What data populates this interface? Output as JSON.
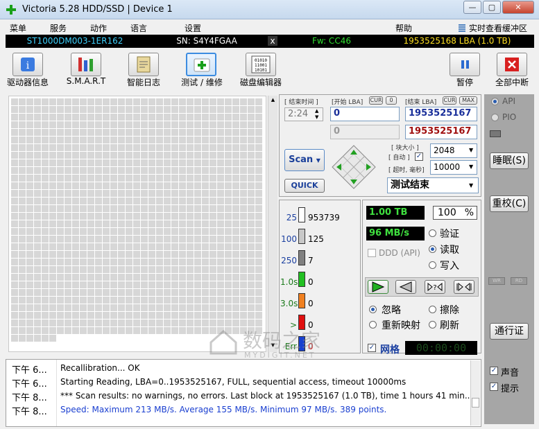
{
  "window": {
    "title": "Victoria 5.28 HDD/SSD | Device 1",
    "min": "—",
    "max": "▢",
    "close": "✕"
  },
  "menu": [
    "菜单",
    "服务",
    "动作",
    "语言",
    "设置",
    "帮助",
    "实时查看缓冲区"
  ],
  "info": {
    "model": "ST1000DM003-1ER162",
    "sn": "SN: S4Y4FGAA",
    "x": "x",
    "fw": "Fw: CC46",
    "lba": "1953525168 LBA (1.0 TB)"
  },
  "toolbar": [
    "驱动器信息",
    "S.M.A.R.T",
    "智能日志",
    "测试 / 维修",
    "磁盘编辑器",
    "暂停",
    "全部中断"
  ],
  "scan": {
    "end_time_label": "[ 结束时间 ]",
    "start_lba_label": "[开始 LBA]",
    "cur": "CUR",
    "zero": "0",
    "end_lba_label": "[结束 LBA]",
    "cur2": "CUR",
    "max": "MAX",
    "time": "2:24",
    "start_lba": "0",
    "end_lba": "1953525167",
    "start_lba2": "0",
    "end_lba2": "1953525167",
    "scan_btn": "Scan",
    "quick_btn": "QUICK",
    "block_size_label": "[ 块大小 ]",
    "auto_label": "[ 自动 ]",
    "timeout_label": "[ 超时, 毫秒]",
    "block_size": "2048",
    "timeout": "10000",
    "status": "测试结束"
  },
  "counters": [
    {
      "label": "25",
      "value": "953739",
      "color": "#ffffff"
    },
    {
      "label": "100",
      "value": "125",
      "color": "#c8c8c8"
    },
    {
      "label": "250",
      "value": "7",
      "color": "#808080"
    },
    {
      "label": "1.0s",
      "value": "0",
      "color": "#22c022"
    },
    {
      "label": "3.0s",
      "value": "0",
      "color": "#f08020"
    },
    {
      "label": ">",
      "value": "0",
      "color": "#e01010"
    },
    {
      "label": "Err",
      "value": "0",
      "color": "#1840d0"
    }
  ],
  "progress": {
    "size": "1.00 TB",
    "percent": "100",
    "pct_sign": "%",
    "speed": "96 MB/s",
    "ddd": "DDD (API)"
  },
  "modes": [
    "验证",
    "读取",
    "写入"
  ],
  "actions": [
    "忽略",
    "擦除",
    "重新映射",
    "刷新"
  ],
  "grid_label": "网格",
  "timer": "00:00:00",
  "side": {
    "api": "API",
    "pio": "PIO",
    "sleep": "睡眠(S)",
    "recal": "重校(C)",
    "passport": "通行证",
    "sound": "声音",
    "hints": "提示",
    "b1": "WR",
    "b2": "RD"
  },
  "log": [
    {
      "t": "下午 6...",
      "m": "Recallibration... OK",
      "c": "#000"
    },
    {
      "t": "下午 6...",
      "m": "Starting Reading, LBA=0..1953525167, FULL, sequential access, timeout 10000ms",
      "c": "#000"
    },
    {
      "t": "下午 8...",
      "m": "*** Scan results: no warnings, no errors. Last block at 1953525167 (1.0 TB), time 1 hours 41 min...",
      "c": "#000"
    },
    {
      "t": "下午 8...",
      "m": "Speed: Maximum 213 MB/s. Average 155 MB/s. Minimum 97 MB/s. 389 points.",
      "c": "#1a3fd0"
    }
  ],
  "watermark": {
    "cn": "数码之家",
    "en": "MYDIGIT.NET"
  }
}
